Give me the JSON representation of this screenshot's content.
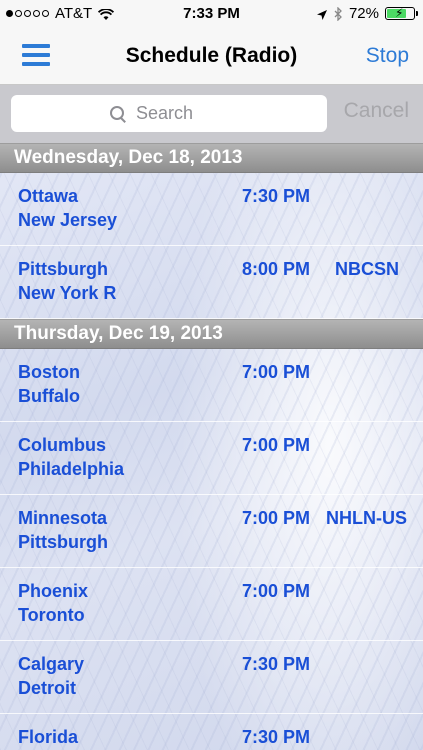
{
  "status_bar": {
    "carrier": "AT&T",
    "time": "7:33 PM",
    "battery": "72%",
    "battery_level": 0.72
  },
  "nav": {
    "title": "Schedule (Radio)",
    "stop_label": "Stop"
  },
  "search": {
    "placeholder": "Search",
    "cancel_label": "Cancel"
  },
  "sections": [
    {
      "date": "Wednesday, Dec 18, 2013",
      "games": [
        {
          "home": "Ottawa",
          "away": "New Jersey",
          "time": "7:30 PM",
          "network": ""
        },
        {
          "home": "Pittsburgh",
          "away": "New York R",
          "time": "8:00 PM",
          "network": "NBCSN"
        }
      ]
    },
    {
      "date": "Thursday, Dec 19, 2013",
      "games": [
        {
          "home": "Boston",
          "away": "Buffalo",
          "time": "7:00 PM",
          "network": ""
        },
        {
          "home": "Columbus",
          "away": "Philadelphia",
          "time": "7:00 PM",
          "network": ""
        },
        {
          "home": "Minnesota",
          "away": "Pittsburgh",
          "time": "7:00 PM",
          "network": "NHLN-US"
        },
        {
          "home": "Phoenix",
          "away": "Toronto",
          "time": "7:00 PM",
          "network": ""
        },
        {
          "home": "Calgary",
          "away": "Detroit",
          "time": "7:30 PM",
          "network": ""
        },
        {
          "home": "Florida",
          "away": "",
          "time": "7:30 PM",
          "network": ""
        }
      ]
    }
  ]
}
